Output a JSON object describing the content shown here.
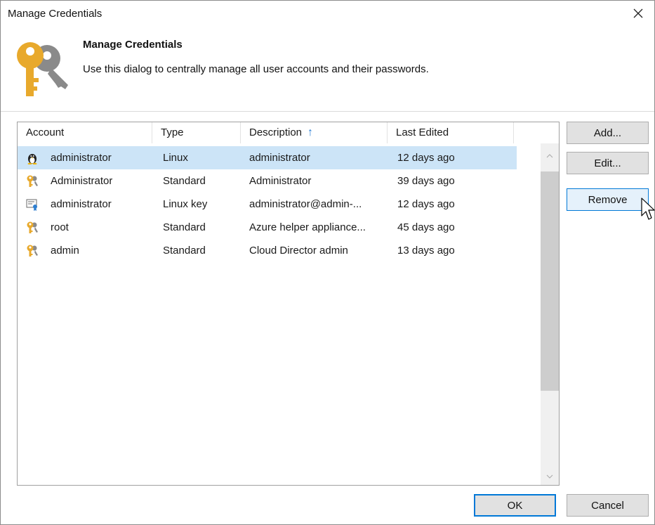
{
  "window": {
    "title": "Manage Credentials"
  },
  "banner": {
    "title": "Manage Credentials",
    "description": "Use this dialog to centrally manage all user accounts and their passwords.",
    "icon": "keys-icon"
  },
  "table": {
    "columns": [
      {
        "label": "Account"
      },
      {
        "label": "Type"
      },
      {
        "label": "Description",
        "sort": "ascending"
      },
      {
        "label": "Last Edited"
      }
    ],
    "rows": [
      {
        "icon": "linux-penguin-icon",
        "account": "administrator",
        "type": "Linux",
        "description": "administrator",
        "last_edited": "12 days ago",
        "selected": true
      },
      {
        "icon": "key-user-icon",
        "account": "Administrator",
        "type": "Standard",
        "description": "Administrator",
        "last_edited": "39 days ago",
        "selected": false
      },
      {
        "icon": "certificate-key-icon",
        "account": "administrator",
        "type": "Linux key",
        "description": "administrator@admin-...",
        "last_edited": "12 days ago",
        "selected": false
      },
      {
        "icon": "key-user-icon",
        "account": "root",
        "type": "Standard",
        "description": "Azure helper appliance...",
        "last_edited": "45 days ago",
        "selected": false
      },
      {
        "icon": "key-user-icon",
        "account": "admin",
        "type": "Standard",
        "description": "Cloud Director admin",
        "last_edited": "13 days ago",
        "selected": false
      }
    ]
  },
  "buttons": {
    "add": "Add...",
    "edit": "Edit...",
    "remove": "Remove",
    "ok": "OK",
    "cancel": "Cancel"
  },
  "colors": {
    "accent": "#0078d7",
    "selection": "#cce4f7",
    "key_gold": "#e8a92c",
    "key_gray": "#8a8a8a"
  }
}
